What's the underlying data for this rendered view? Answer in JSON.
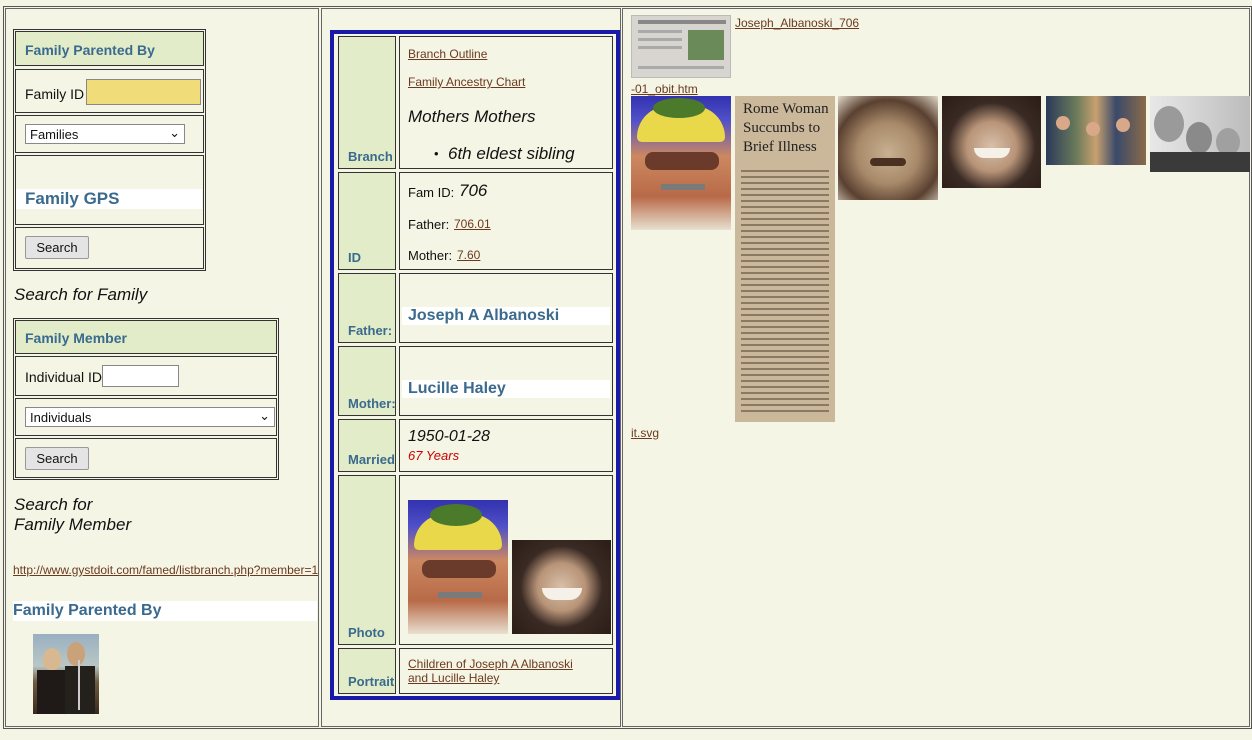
{
  "left": {
    "family_parented_by_header": "Family Parented By",
    "family_id_label": "Family ID",
    "family_id_value": "",
    "families_select": "Families",
    "family_gps": "Family GPS",
    "search_button_1": "Search",
    "search_for_family": "Search for Family",
    "family_member_header": "Family Member",
    "individual_id_label": "Individual ID",
    "individual_id_value": "",
    "individuals_select": "Individuals",
    "search_button_2": "Search",
    "search_for_member_line1": "Search for",
    "search_for_member_line2": "Family Member",
    "url_link": "http://www.gystdoit.com/famed/listbranch.php?member=1",
    "family_parented_by_title": "Family Parented By"
  },
  "middle": {
    "labels": {
      "branch": "Branch",
      "id": "ID",
      "father": "Father:",
      "mother": "Mother:",
      "married": "Married",
      "photo": "Photo",
      "portrait": "Portrait"
    },
    "branch_outline": "Branch Outline",
    "family_ancestry_chart": "Family Ancestry Chart",
    "branch_title": "Mothers Mothers",
    "sibling_note": "6th eldest sibling",
    "fam_id_label": "Fam ID:",
    "fam_id_value": "706",
    "father_label": "Father:",
    "father_id": "706.01",
    "mother_label": "Mother:",
    "mother_id": "7.60",
    "father_name": "Joseph A Albanoski",
    "mother_name": "Lucille Haley",
    "married_date": "1950-01-28",
    "married_years": "67 Years",
    "portrait_line1": "Children of Joseph A Albanoski",
    "portrait_line2": "and Lucille Haley"
  },
  "right": {
    "top_link": "Joseph_Albanoski_706",
    "obit_link": "-01_obit.htm",
    "svg_link": "it.svg",
    "newspaper_headline": "Rome Woman Succumbs to Brief Illness"
  },
  "colors": {
    "background": "#f5f5e6",
    "header_fill": "#e2ecc8",
    "header_text": "#3a6a8e",
    "table_border": "#1a1aa8",
    "years_red": "#cc0000",
    "input_yellow": "#f0dc78"
  }
}
